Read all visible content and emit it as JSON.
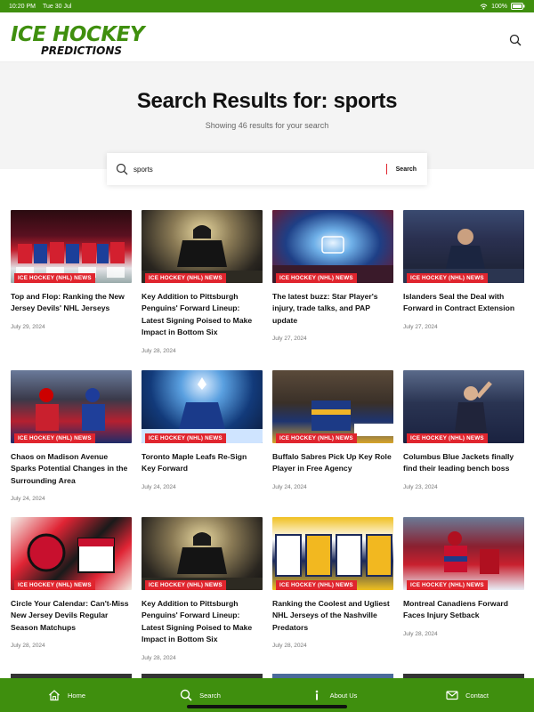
{
  "status_bar": {
    "time": "10:20 PM",
    "date": "Tue 30 Jul",
    "battery": "100%"
  },
  "header": {
    "logo_line1": "ICE HOCKEY",
    "logo_line2": "PREDICTIONS",
    "search_icon": "search-icon"
  },
  "hero": {
    "title": "Search Results for: sports",
    "subtitle": "Showing 46 results for your search"
  },
  "search": {
    "value": "sports",
    "button_label": "Search"
  },
  "articles": [
    {
      "tag": "ICE HOCKEY (NHL) NEWS",
      "title": "Top and Flop: Ranking the New Jersey Devils' NHL Jerseys",
      "date": "July 29, 2024"
    },
    {
      "tag": "ICE HOCKEY (NHL) NEWS",
      "title": "Key Addition to Pittsburgh Penguins' Forward Lineup: Latest Signing Poised to Make Impact in Bottom Six",
      "date": "July 28, 2024"
    },
    {
      "tag": "ICE HOCKEY (NHL) NEWS",
      "title": "The latest buzz: Star Player's injury, trade talks, and PAP update",
      "date": "July 27, 2024"
    },
    {
      "tag": "ICE HOCKEY (NHL) NEWS",
      "title": "Islanders Seal the Deal with Forward in Contract Extension",
      "date": "July 27, 2024"
    },
    {
      "tag": "ICE HOCKEY (NHL) NEWS",
      "title": "Chaos on Madison Avenue Sparks Potential Changes in the Surrounding Area",
      "date": "July 24, 2024"
    },
    {
      "tag": "ICE HOCKEY (NHL) NEWS",
      "title": "Toronto Maple Leafs Re-Sign Key Forward",
      "date": "July 24, 2024"
    },
    {
      "tag": "ICE HOCKEY (NHL) NEWS",
      "title": "Buffalo Sabres Pick Up Key Role Player in Free Agency",
      "date": "July 24, 2024"
    },
    {
      "tag": "ICE HOCKEY (NHL) NEWS",
      "title": "Columbus Blue Jackets finally find their leading bench boss",
      "date": "July 23, 2024"
    },
    {
      "tag": "ICE HOCKEY (NHL) NEWS",
      "title": "Circle Your Calendar: Can't-Miss New Jersey Devils Regular Season Matchups",
      "date": "July 28, 2024"
    },
    {
      "tag": "ICE HOCKEY (NHL) NEWS",
      "title": "Key Addition to Pittsburgh Penguins' Forward Lineup: Latest Signing Poised to Make Impact in Bottom Six",
      "date": "July 28, 2024"
    },
    {
      "tag": "ICE HOCKEY (NHL) NEWS",
      "title": "Ranking the Coolest and Ugliest NHL Jerseys of the Nashville Predators",
      "date": "July 28, 2024"
    },
    {
      "tag": "ICE HOCKEY (NHL) NEWS",
      "title": "Montreal Canadiens Forward Faces Injury Setback",
      "date": "July 28, 2024"
    }
  ],
  "bottom_nav": [
    {
      "label": "Home",
      "icon": "home-icon"
    },
    {
      "label": "Search",
      "icon": "search-icon"
    },
    {
      "label": "About Us",
      "icon": "info-icon"
    },
    {
      "label": "Contact",
      "icon": "mail-icon"
    }
  ],
  "colors": {
    "brand_green": "#3f8f0e",
    "tag_red": "#e0252e"
  }
}
